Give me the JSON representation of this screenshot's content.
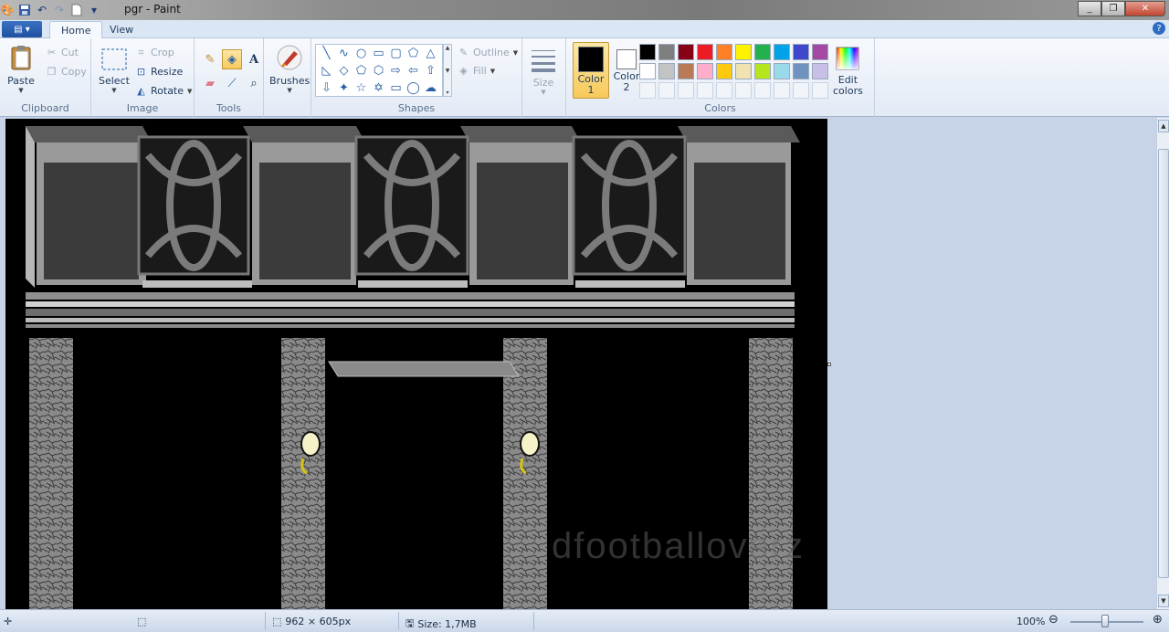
{
  "window": {
    "title": "pgr - Paint"
  },
  "qat": {
    "icons": [
      "paint-app-icon",
      "save-icon",
      "undo-icon",
      "redo-icon",
      "new-icon",
      "customize-icon"
    ]
  },
  "tabs": [
    {
      "label": "Home"
    },
    {
      "label": "View"
    }
  ],
  "clipboard": {
    "group": "Clipboard",
    "paste": "Paste",
    "cut": "Cut",
    "copy": "Copy"
  },
  "image": {
    "group": "Image",
    "select": "Select",
    "crop": "Crop",
    "resize": "Resize",
    "rotate": "Rotate"
  },
  "tools": {
    "group": "Tools"
  },
  "brushes": {
    "label": "Brushes"
  },
  "shapes": {
    "group": "Shapes",
    "outline": "Outline",
    "fill": "Fill"
  },
  "size": {
    "label": "Size"
  },
  "colors": {
    "group": "Colors",
    "color1_line1": "Color",
    "color1_line2": "1",
    "color2_line1": "Color",
    "color2_line2": "2",
    "edit_line1": "Edit",
    "edit_line2": "colors",
    "color1_value": "#000000",
    "color2_value": "#ffffff",
    "palette_row1": [
      "#000000",
      "#7f7f7f",
      "#880015",
      "#ed1c24",
      "#ff7f27",
      "#fff200",
      "#22b14c",
      "#00a2e8",
      "#3f48cc",
      "#a349a4"
    ],
    "palette_row2": [
      "#ffffff",
      "#c3c3c3",
      "#b97a57",
      "#ffaec9",
      "#ffc90e",
      "#efe4b0",
      "#b5e61d",
      "#99d9ea",
      "#7092be",
      "#c8bfe7"
    ]
  },
  "canvas": {
    "watermark": "dfootballoverz"
  },
  "status": {
    "dimensions": "962 × 605px",
    "size": "Size: 1,7MB",
    "zoom": "100%"
  }
}
